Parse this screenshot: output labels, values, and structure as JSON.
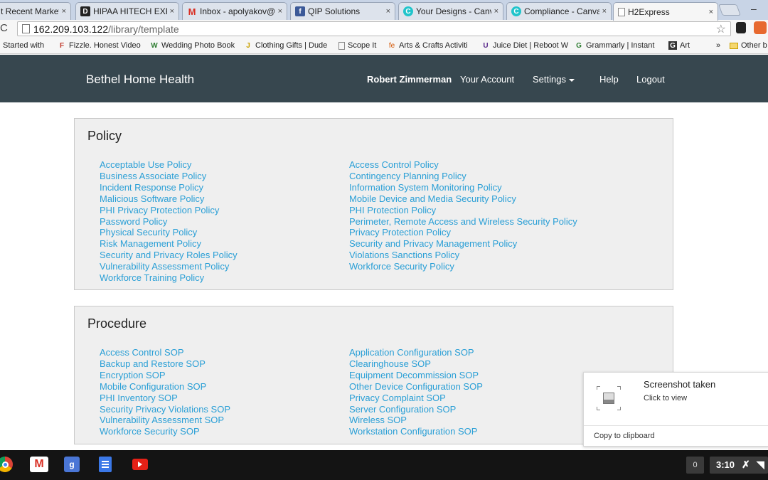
{
  "browser": {
    "tabs": [
      {
        "label": "t Recent Marketi",
        "favicon": "",
        "active": false
      },
      {
        "label": "HIPAA HITECH EXPF",
        "favicon": "D",
        "active": false
      },
      {
        "label": "Inbox - apolyakov@q",
        "favicon": "M",
        "active": false
      },
      {
        "label": "QIP Solutions",
        "favicon": "f",
        "active": false
      },
      {
        "label": "Your Designs - Canva",
        "favicon": "C",
        "active": false
      },
      {
        "label": "Compliance - Canva",
        "favicon": "C",
        "active": false
      },
      {
        "label": "H2Express",
        "favicon": "page",
        "active": true
      }
    ],
    "tab_close_glyph": "×",
    "minimize_glyph": "–",
    "reload_glyph": "C",
    "url_host": "162.209.103.122",
    "url_path": "/library/template",
    "star_glyph": "☆",
    "bookmarks": [
      {
        "label": "Started with",
        "icon": ""
      },
      {
        "label": "Fizzle. Honest Video",
        "icon": "F"
      },
      {
        "label": "Wedding Photo Book",
        "icon": "W"
      },
      {
        "label": "Clothing Gifts | Dude",
        "icon": "J"
      },
      {
        "label": "Scope It",
        "icon": "page"
      },
      {
        "label": "Arts & Crafts Activiti",
        "icon": "fe"
      },
      {
        "label": "Juice Diet | Reboot W",
        "icon": "U"
      },
      {
        "label": "Grammarly | Instant",
        "icon": "G"
      },
      {
        "label": "Art",
        "icon": "G"
      }
    ],
    "bookmarks_overflow": "»",
    "other_bookmarks": "Other b"
  },
  "site": {
    "brand": "Bethel Home Health",
    "user": "Robert Zimmerman",
    "nav": {
      "account": "Your Account",
      "settings": "Settings",
      "help": "Help",
      "logout": "Logout"
    },
    "colors": {
      "nav_bg": "#37474f",
      "link": "#2a9fd6",
      "panel_bg": "#efefef"
    }
  },
  "policy": {
    "title": "Policy",
    "left": [
      "Acceptable Use Policy",
      "Business Associate Policy",
      "Incident Response Policy",
      "Malicious Software Policy",
      "PHI Privacy Protection Policy",
      "Password Policy",
      "Physical Security Policy",
      "Risk Management Policy",
      "Security and Privacy Roles Policy",
      "Vulnerability Assessment Policy",
      "Workforce Training Policy"
    ],
    "right": [
      "Access Control Policy",
      "Contingency Planning Policy",
      "Information System Monitoring Policy",
      "Mobile Device and Media Security Policy",
      "PHI Protection Policy",
      "Perimeter, Remote Access and Wireless Security Policy",
      "Privacy Protection Policy",
      "Security and Privacy Management Policy",
      "Violations Sanctions Policy",
      "Workforce Security Policy"
    ]
  },
  "procedure": {
    "title": "Procedure",
    "left": [
      "Access Control SOP",
      "Backup and Restore SOP",
      "Encryption SOP",
      "Mobile Configuration SOP",
      "PHI Inventory SOP",
      "Security Privacy Violations SOP",
      "Vulnerability Assessment SOP",
      "Workforce Security SOP"
    ],
    "right": [
      "Application Configuration SOP",
      "Clearinghouse SOP",
      "Equipment Decommission SOP",
      "Other Device Configuration SOP",
      "Privacy Complaint SOP",
      "Server Configuration SOP",
      "Wireless SOP",
      "Workstation Configuration SOP"
    ]
  },
  "toast": {
    "title": "Screenshot taken",
    "subtitle": "Click to view",
    "action": "Copy to clipboard"
  },
  "shelf": {
    "apps": [
      "chrome-icon",
      "gmail-icon",
      "google-search-icon",
      "docs-icon",
      "youtube-icon"
    ],
    "notification_count": "0",
    "clock": "3:10"
  }
}
